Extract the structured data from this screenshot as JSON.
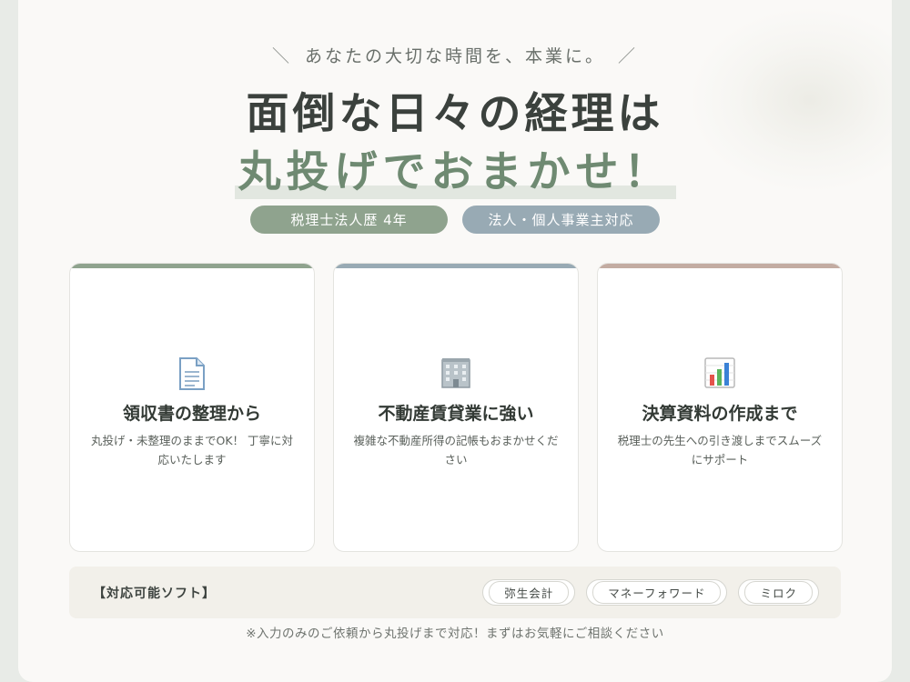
{
  "hero": {
    "tagline": "あなたの大切な時間を、本業に。",
    "slash_left": "＼",
    "slash_right": "／",
    "headline_line1": "面倒な日々の経理は",
    "headline_line2": "丸投げでおまかせ！"
  },
  "badges": [
    {
      "label": "税理士法人歴 4年",
      "color": "#8fa38e"
    },
    {
      "label": "法人・個人事業主対応",
      "color": "#98aab4"
    }
  ],
  "cards": [
    {
      "icon": "document-icon",
      "accent": "#8fa38e",
      "title": "領収書の整理から",
      "description": "丸投げ・未整理のままでOK！ 丁寧に対応いたします"
    },
    {
      "icon": "building-icon",
      "accent": "#98aab4",
      "title": "不動産賃貸業に強い",
      "description": "複雑な不動産所得の記帳もおまかせください"
    },
    {
      "icon": "bar-chart-icon",
      "accent": "#c3aca2",
      "title": "決算資料の作成まで",
      "description": "税理士の先生への引き渡しまでスムーズにサポート"
    }
  ],
  "software": {
    "label": "【対応可能ソフト】",
    "items": [
      "弥生会計",
      "マネーフォワード",
      "ミロク"
    ]
  },
  "note": "※入力のみのご依頼から丸投げまで対応！まずはお気軽にご相談ください"
}
